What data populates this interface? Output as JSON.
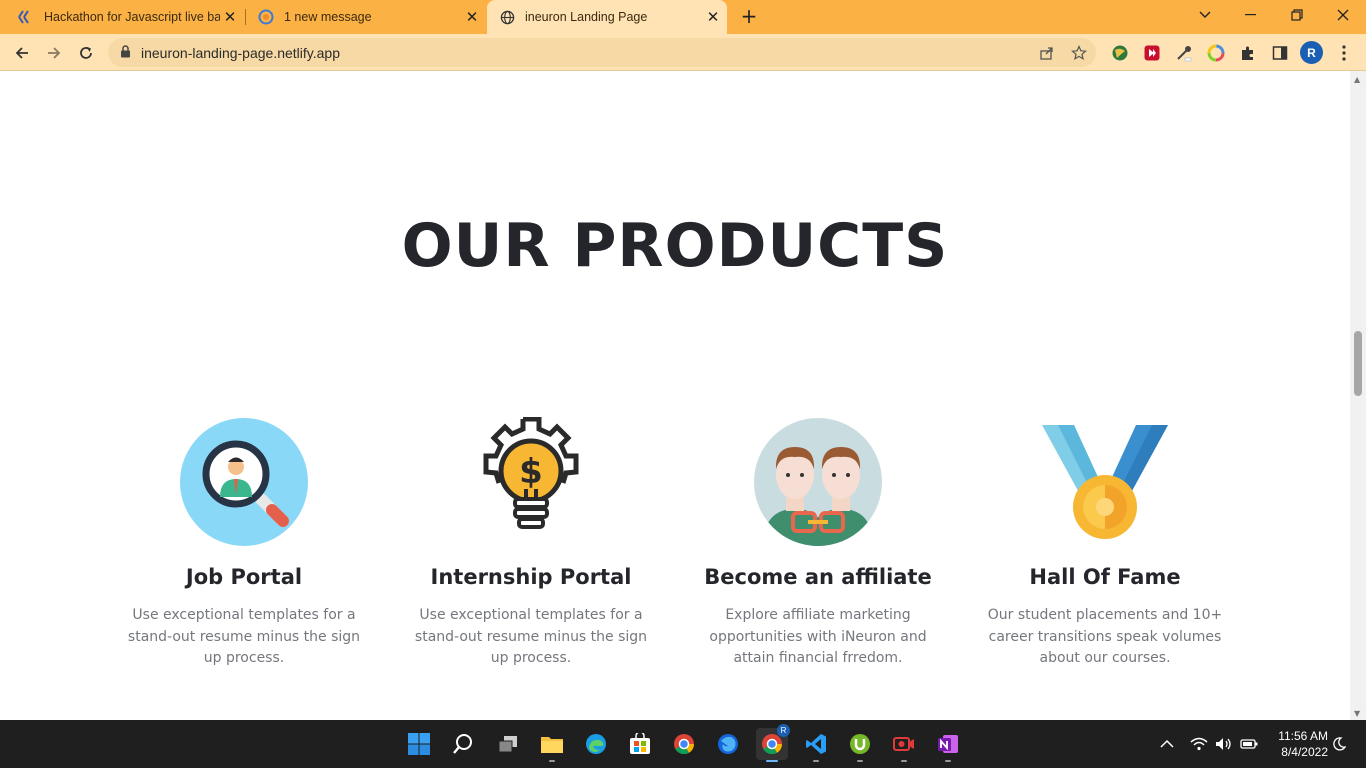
{
  "browser": {
    "tabs": [
      {
        "title": "Hackathon for Javascript live batc",
        "favicon": "dev-logo-icon"
      },
      {
        "title": "1 new message",
        "favicon": "chat-icon"
      },
      {
        "title": "ineuron Landing Page",
        "favicon": "globe-icon"
      }
    ],
    "active_tab": 2,
    "url": "ineuron-landing-page.netlify.app",
    "profile_initial": "R"
  },
  "page": {
    "heading": "OUR PRODUCTS",
    "products": [
      {
        "title": "Job Portal",
        "description": "Use exceptional templates for a stand-out resume minus the sign up process.",
        "icon": "magnifier-person-icon"
      },
      {
        "title": "Internship Portal",
        "description": "Use exceptional templates for a stand-out resume minus the sign up process.",
        "icon": "lightbulb-gear-dollar-icon"
      },
      {
        "title": "Become an affiliate",
        "description": "Explore affiliate marketing opportunities with iNeuron and attain financial frredom.",
        "icon": "linked-people-icon"
      },
      {
        "title": "Hall Of Fame",
        "description": "Our student placements and 10+ career transitions speak volumes about our courses.",
        "icon": "medal-icon"
      }
    ]
  },
  "taskbar": {
    "time": "11:56 AM",
    "date": "8/4/2022",
    "chrome_badge": "R"
  },
  "colors": {
    "tab_strip": "#fbb144",
    "toolbar": "#ffe3b5",
    "heading": "#24262b",
    "body_text": "#74777d",
    "taskbar": "#1f1f1f"
  }
}
